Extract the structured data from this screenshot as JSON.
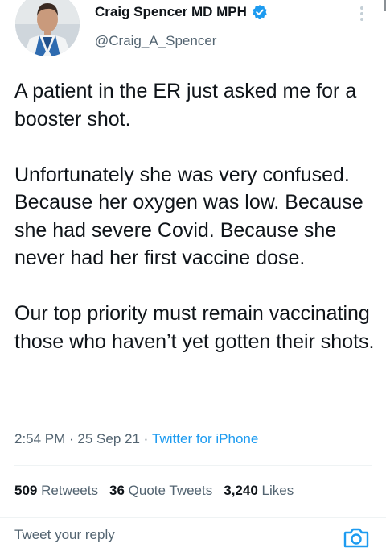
{
  "author": {
    "name": "Craig Spencer MD MPH",
    "handle": "@Craig_A_Spencer",
    "verified_color": "#1d9bf0"
  },
  "tweet": {
    "paragraphs": [
      "A patient in the ER just asked me for a booster shot.",
      "Unfortunately she was very confused. Because her oxygen was low. Because she had severe Covid. Because she never had her first vaccine dose.",
      "Our top priority must remain vaccinating those who haven’t yet gotten their shots."
    ],
    "time": "2:54 PM",
    "date": "25 Sep 21",
    "source": "Twitter for iPhone",
    "separator": " · "
  },
  "stats": {
    "retweets_count": "509",
    "retweets_label": "Retweets",
    "quote_count": "36",
    "quote_label": "Quote Tweets",
    "likes_count": "3,240",
    "likes_label": "Likes"
  },
  "reply": {
    "placeholder": "Tweet your reply"
  },
  "icons": {
    "verified": "verified-badge-icon",
    "more": "more-vertical-icon",
    "camera": "camera-icon"
  },
  "colors": {
    "link": "#1d9bf0",
    "secondary_text": "#536471",
    "primary_text": "#0f1419"
  }
}
